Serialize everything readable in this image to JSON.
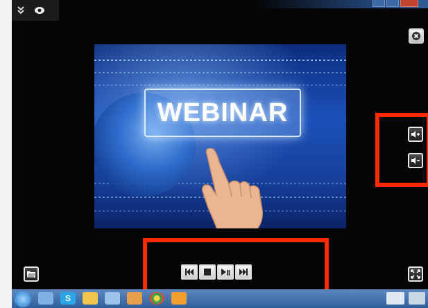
{
  "top_toolbar": {
    "collapse_icon": "double-chevron-down-icon",
    "view_icon": "eye-icon"
  },
  "video": {
    "headline": "WEBINAR"
  },
  "side_buttons": {
    "close_icon": "close-icon",
    "volume_up_icon": "volume-up-icon",
    "volume_down_icon": "volume-down-icon",
    "folder_icon": "open-folder-icon",
    "fullscreen_icon": "fullscreen-icon"
  },
  "playback_controls": [
    "previous-icon",
    "stop-icon",
    "play-pause-icon",
    "next-icon"
  ],
  "taskbar": {
    "icons": [
      "start-icon",
      "explorer-icon",
      "skype-icon",
      "folder-icon",
      "window-icon",
      "app-icon",
      "chrome-icon",
      "media-icon"
    ],
    "skype_label": "S"
  },
  "highlight_color": "#ff2a00"
}
